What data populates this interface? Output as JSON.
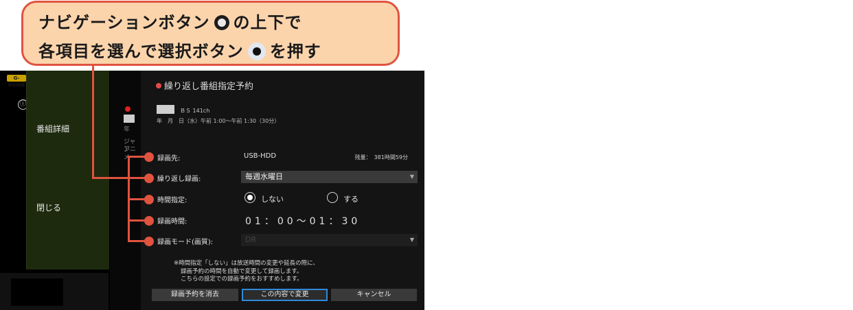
{
  "callout": {
    "line1_a": "ナビゲーションボタン",
    "line1_b": "の上下で",
    "line2_a": "各項目を選んで選択ボタン",
    "line2_b": "を押す"
  },
  "sidebar": {
    "logo": "G-GUIDE",
    "info_icon": "ⓘ",
    "item_detail": "番組詳細",
    "item_close": "閉じる"
  },
  "background": {
    "genre_a": "ジャン",
    "genre_b": "アニメ",
    "year": "年"
  },
  "dialog": {
    "title": "繰り返し番組指定予約",
    "channel": "ＢＳ 141ch",
    "date_time": "年　月　日（水）午前 1:00〜午前 1:30（30分）",
    "rows": {
      "dest_label": "録画先:",
      "dest_value": "USB-HDD",
      "remain": "残量：　381時間59分",
      "repeat_label": "繰り返し録画:",
      "repeat_value": "毎週水曜日",
      "time_spec_label": "時間指定:",
      "opt_no": "しない",
      "opt_yes": "する",
      "rec_time_label": "録画時間:",
      "rec_time_value": "01：00〜01：30",
      "mode_label": "録画モード(画質):",
      "mode_value": "DR"
    },
    "note": [
      "※時間指定「しない」は放送時間の変更や延長の際に、",
      "録画予約の時間を自動で変更して録画します。",
      "こちらの設定での録画予約をおすすめします。"
    ],
    "buttons": {
      "delete": "録画予約を消去",
      "apply": "この内容で変更",
      "cancel": "キャンセル"
    }
  },
  "colors": {
    "callout_bg": "#fbd4ac",
    "callout_border": "#e0533f",
    "focus_border": "#2f8ad8"
  }
}
